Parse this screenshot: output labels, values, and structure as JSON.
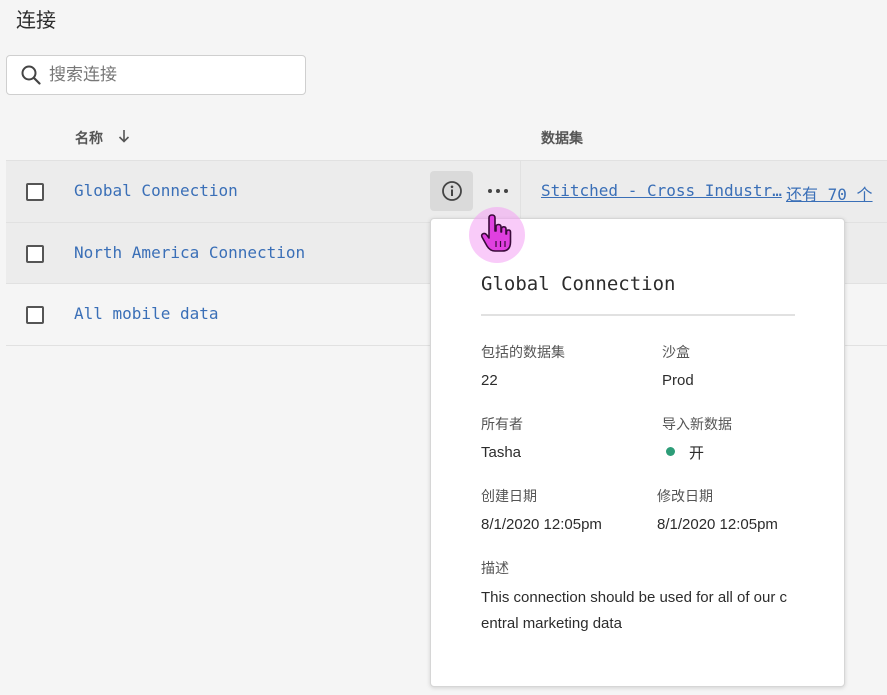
{
  "page": {
    "title": "连接"
  },
  "search": {
    "placeholder": "搜索连接",
    "icon": "search-icon"
  },
  "table": {
    "columns": {
      "name": "名称",
      "datasets": "数据集"
    },
    "rows": [
      {
        "name": "Global Connection",
        "dataset": "Stitched - Cross Industr…",
        "more": "还有 70 个"
      },
      {
        "name": "North America Connection"
      },
      {
        "name": "All mobile data"
      }
    ]
  },
  "popover": {
    "title": "Global Connection",
    "datasets_label": "包括的数据集",
    "datasets_value": "22",
    "sandbox_label": "沙盒",
    "sandbox_value": "Prod",
    "owner_label": "所有者",
    "owner_value": "Tasha",
    "import_label": "导入新数据",
    "import_value": "开",
    "created_label": "创建日期",
    "created_value": "8/1/2020 12:05pm",
    "modified_label": "修改日期",
    "modified_value": "8/1/2020 12:05pm",
    "description_label": "描述",
    "description_value": "This connection should be used for all of our central marketing data"
  },
  "colors": {
    "link": "#3a6fb7",
    "status_on": "#2d9d78",
    "cursor": "#e040e0"
  }
}
